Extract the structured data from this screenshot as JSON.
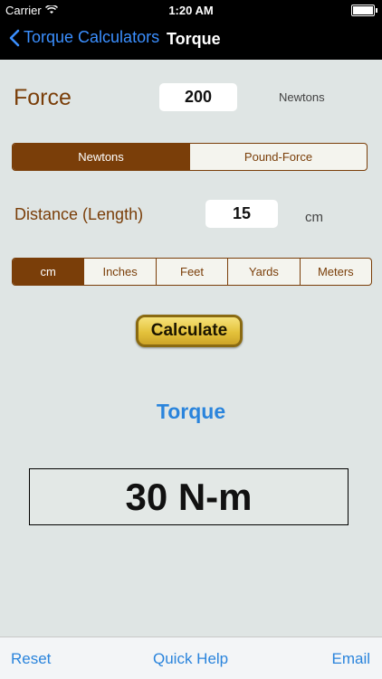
{
  "status": {
    "carrier": "Carrier",
    "time": "1:20 AM",
    "wifi_icon": "wifi-icon",
    "battery_icon": "battery-icon"
  },
  "nav": {
    "back_label": "Torque Calculators",
    "title": "Torque"
  },
  "force": {
    "label": "Force",
    "value": "200",
    "unit": "Newtons",
    "options": [
      "Newtons",
      "Pound-Force"
    ],
    "selected": "Newtons"
  },
  "distance": {
    "label": "Distance (Length)",
    "value": "15",
    "unit": "cm",
    "options": [
      "cm",
      "Inches",
      "Feet",
      "Yards",
      "Meters"
    ],
    "selected": "cm"
  },
  "calculate_label": "Calculate",
  "result": {
    "label": "Torque",
    "value": "30 N-m"
  },
  "toolbar": {
    "reset": "Reset",
    "help": "Quick Help",
    "email": "Email"
  },
  "colors": {
    "accent_brown": "#7a3e09",
    "link_blue": "#2a84dc",
    "background": "#dfe5e4"
  }
}
